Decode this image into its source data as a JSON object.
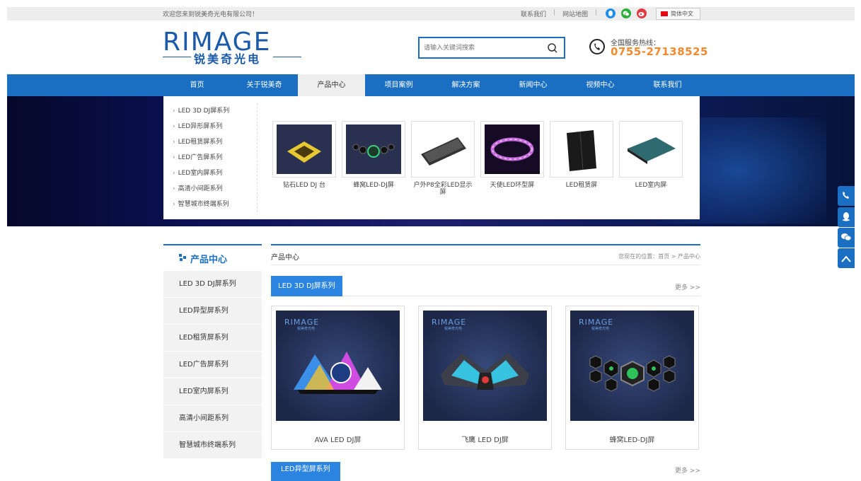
{
  "topbar": {
    "welcome": "欢迎您来到锐美奇光电有限公司！",
    "links": [
      "联系我们",
      "网站地图"
    ],
    "lang": "简体中文"
  },
  "logo": {
    "word": "RIMAGE",
    "cn": "锐美奇光电"
  },
  "search": {
    "placeholder": "请输入关键词搜索"
  },
  "hotline": {
    "label": "全国服务热线：",
    "number": "0755-27138525"
  },
  "nav": {
    "items": [
      "首页",
      "关于锐美奇",
      "产品中心",
      "项目案例",
      "解决方案",
      "新闻中心",
      "视频中心",
      "联系我们"
    ],
    "active": "产品中心"
  },
  "dropdown": {
    "categories": [
      "LED 3D DJ屏系列",
      "LED异形屏系列",
      "LED租赁屏系列",
      "LED广告屏系列",
      "LED室内屏系列",
      "高清小间距系列",
      "智慧城市终端系列"
    ],
    "products": [
      "钻石LED DJ 台",
      "蜂窝LED-DJ屏",
      "户外P8全彩LED显示屏",
      "天使LED环型屏",
      "LED租赁屏",
      "LED室内屏"
    ]
  },
  "sidebar": {
    "title": "产品中心",
    "items": [
      "LED 3D DJ屏系列",
      "LED异型屏系列",
      "LED租赁屏系列",
      "LED广告屏系列",
      "LED室内屏系列",
      "高清小间距系列",
      "智慧城市终端系列"
    ]
  },
  "content": {
    "title": "产品中心",
    "breadcrumb": "您现在的位置：首页 > 产品中心",
    "section1": {
      "tab": "LED 3D DJ屏系列",
      "more": "更多 >>"
    },
    "cards": [
      {
        "brand": "RIMAGE",
        "sub": "锐美奇光电",
        "caption": "AVA LED DJ屏"
      },
      {
        "brand": "RIMAGE",
        "sub": "锐美奇光电",
        "caption": "飞鹰 LED DJ屏"
      },
      {
        "brand": "RIMAGE",
        "sub": "锐美奇光电",
        "caption": "蜂窝LED-DJ屏"
      }
    ],
    "section2": {
      "tab": "LED异型屏系列",
      "more": "更多 >>"
    }
  },
  "colors": {
    "primary": "#1a6fc2",
    "accent": "#f2892d",
    "tab": "#2a84e0"
  }
}
